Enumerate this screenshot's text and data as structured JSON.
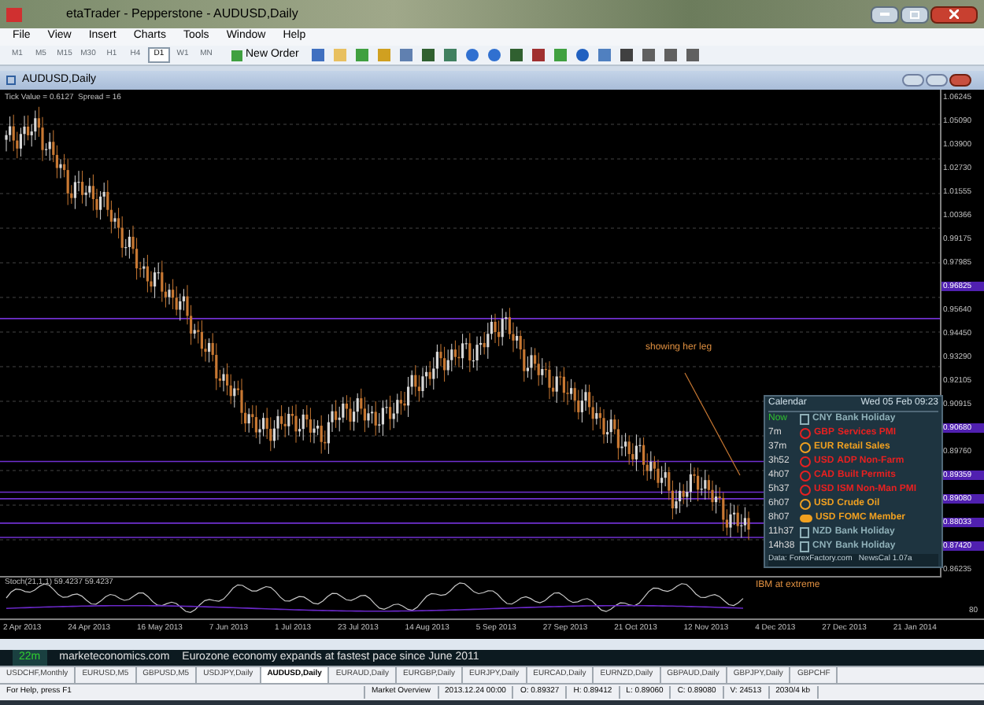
{
  "window": {
    "title": "etaTrader - Pepperstone - AUDUSD,Daily"
  },
  "menu": [
    "File",
    "View",
    "Insert",
    "Charts",
    "Tools",
    "Window",
    "Help"
  ],
  "timeframes": [
    {
      "label": "M1",
      "selected": false
    },
    {
      "label": "M5",
      "selected": false
    },
    {
      "label": "M15",
      "selected": false
    },
    {
      "label": "M30",
      "selected": false
    },
    {
      "label": "H1",
      "selected": false
    },
    {
      "label": "H4",
      "selected": false
    },
    {
      "label": "D1",
      "selected": true
    },
    {
      "label": "W1",
      "selected": false
    },
    {
      "label": "MN",
      "selected": false
    }
  ],
  "toolbar": {
    "new_order": "New Order"
  },
  "chart": {
    "title": "AUDUSD,Daily",
    "info": "Tick Value = 0.6127  Spread = 16",
    "price_axis": [
      {
        "label": "1.06245",
        "highlighted": false
      },
      {
        "label": "1.05090",
        "highlighted": false
      },
      {
        "label": "1.03900",
        "highlighted": false
      },
      {
        "label": "1.02730",
        "highlighted": false
      },
      {
        "label": "1.01555",
        "highlighted": false
      },
      {
        "label": "1.00366",
        "highlighted": false
      },
      {
        "label": "0.99175",
        "highlighted": false
      },
      {
        "label": "0.97985",
        "highlighted": false
      },
      {
        "label": "0.96825",
        "highlighted": true
      },
      {
        "label": "0.95640",
        "highlighted": false
      },
      {
        "label": "0.94450",
        "highlighted": false
      },
      {
        "label": "0.93290",
        "highlighted": false
      },
      {
        "label": "0.92105",
        "highlighted": false
      },
      {
        "label": "0.90915",
        "highlighted": false
      },
      {
        "label": "0.90680",
        "highlighted": true
      },
      {
        "label": "0.89760",
        "highlighted": false
      },
      {
        "label": "0.89359",
        "highlighted": true
      },
      {
        "label": "0.89080",
        "highlighted": true
      },
      {
        "label": "0.88033",
        "highlighted": true
      },
      {
        "label": "0.87420",
        "highlighted": true
      },
      {
        "label": "0.86235",
        "highlighted": false
      }
    ],
    "annotations": [
      "showing her leg",
      "IBM at extreme"
    ],
    "indicator": {
      "label": "Stoch(21,1,1) 59.4237 59.4237",
      "levels": [
        "80"
      ]
    },
    "dates": [
      "2 Apr 2013",
      "24 Apr 2013",
      "16 May 2013",
      "7 Jun 2013",
      "1 Jul 2013",
      "23 Jul 2013",
      "14 Aug 2013",
      "5 Sep 2013",
      "27 Sep 2013",
      "21 Oct 2013",
      "12 Nov 2013",
      "4 Dec 2013",
      "27 Dec 2013",
      "21 Jan 2014"
    ]
  },
  "calendar": {
    "title": "Calendar",
    "datetime": "Wed 05 Feb 09:23",
    "footer": "Data: ForexFactory.com   NewsCal 1.07a",
    "events": [
      {
        "time": "Now",
        "now": true,
        "kind": "holiday",
        "currency": "CNY",
        "name": "Bank Holiday",
        "color": "#8fb0b8"
      },
      {
        "time": "7m",
        "now": false,
        "kind": "high",
        "currency": "GBP",
        "name": "Services PMI",
        "color": "#e82020"
      },
      {
        "time": "37m",
        "now": false,
        "kind": "medium",
        "currency": "EUR",
        "name": "Retail Sales",
        "color": "#f0a020"
      },
      {
        "time": "3h52",
        "now": false,
        "kind": "high",
        "currency": "USD",
        "name": "ADP Non-Farm",
        "color": "#e82020"
      },
      {
        "time": "4h07",
        "now": false,
        "kind": "high",
        "currency": "CAD",
        "name": "Built Permits",
        "color": "#e82020"
      },
      {
        "time": "5h37",
        "now": false,
        "kind": "high",
        "currency": "USD",
        "name": "ISM Non-Man PMI",
        "color": "#e82020"
      },
      {
        "time": "6h07",
        "now": false,
        "kind": "medium",
        "currency": "USD",
        "name": "Crude Oil",
        "color": "#f0a020"
      },
      {
        "time": "8h07",
        "now": false,
        "kind": "speech",
        "currency": "USD",
        "name": "FOMC Member",
        "color": "#f0a020"
      },
      {
        "time": "11h37",
        "now": false,
        "kind": "holiday",
        "currency": "NZD",
        "name": "Bank Holiday",
        "color": "#8fb0b8"
      },
      {
        "time": "14h38",
        "now": false,
        "kind": "holiday",
        "currency": "CNY",
        "name": "Bank Holiday",
        "color": "#8fb0b8"
      }
    ]
  },
  "news": {
    "age": "22m",
    "source": "marketeconomics.com",
    "headline": "Eurozone economy expands at fastest pace since June 2011"
  },
  "tabs": [
    {
      "label": "USDCHF,Monthly",
      "selected": false
    },
    {
      "label": "EURUSD,M5",
      "selected": false
    },
    {
      "label": "GBPUSD,M5",
      "selected": false
    },
    {
      "label": "USDJPY,Daily",
      "selected": false
    },
    {
      "label": "AUDUSD,Daily",
      "selected": true
    },
    {
      "label": "EURAUD,Daily",
      "selected": false
    },
    {
      "label": "EURGBP,Daily",
      "selected": false
    },
    {
      "label": "EURJPY,Daily",
      "selected": false
    },
    {
      "label": "EURCAD,Daily",
      "selected": false
    },
    {
      "label": "EURNZD,Daily",
      "selected": false
    },
    {
      "label": "GBPAUD,Daily",
      "selected": false
    },
    {
      "label": "GBPJPY,Daily",
      "selected": false
    },
    {
      "label": "GBPCHF",
      "selected": false
    }
  ],
  "status_bar": [
    "For Help, press F1",
    "Market Overview",
    "2013.12.24 00:00",
    "O: 0.89327",
    "H: 0.89412",
    "L: 0.89060",
    "C: 0.89080",
    "V: 24513",
    "2030/4 kb"
  ]
}
